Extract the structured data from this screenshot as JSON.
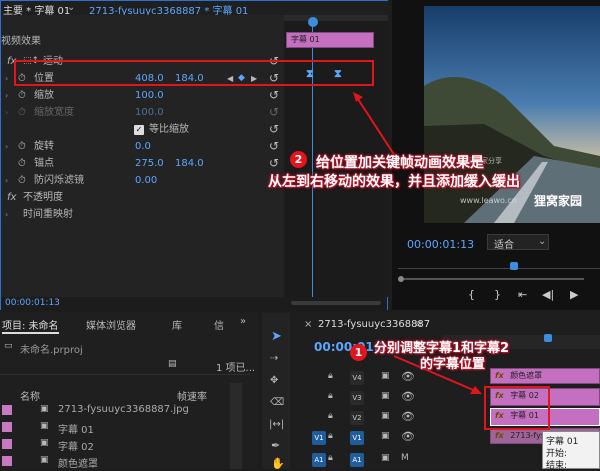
{
  "effect_controls": {
    "tab_title": "主要 * 字幕 01",
    "sequence_clip": "2713-fysuuyc3368887 * 字幕 01",
    "video_effects": "视频效果",
    "motion": "运动",
    "position": {
      "label": "位置",
      "x": "408.0",
      "y": "184.0"
    },
    "scale": {
      "label": "缩放",
      "value": "100.0"
    },
    "scale_width": {
      "label": "缩放宽度",
      "value": "100.0"
    },
    "uniform_scale": "等比缩放",
    "rotation": {
      "label": "旋转",
      "value": "0.0"
    },
    "anchor": {
      "label": "锚点",
      "x": "275.0",
      "y": "184.0"
    },
    "antiflicker": {
      "label": "防闪烁滤镜",
      "value": "0.00"
    },
    "opacity": "不透明度",
    "time_remap": "时间重映射",
    "timecode": "00:00:01:13",
    "timeline_clip": "字幕 01",
    "fx_glyph": "fx"
  },
  "program": {
    "timecode": "00:00:01:13",
    "fit": "适合",
    "watermark_site": "www.leawo.cn",
    "watermark_brand": "狸窝家园",
    "watermark_top": "狸窝万家分享"
  },
  "project": {
    "tab_project": "项目: 未命名",
    "tab_media": "媒体浏览器",
    "tab_library": "库",
    "tab_info": "信",
    "filename": "未命名.prproj",
    "count": "1 项已...",
    "col_name": "名称",
    "col_rate": "帧速率",
    "items": [
      {
        "name": "2713-fysuuyc3368887.jpg",
        "color": "#c77ac0"
      },
      {
        "name": "字幕 01",
        "color": "#c77ac0"
      },
      {
        "name": "字幕 02",
        "color": "#c77ac0"
      },
      {
        "name": "颜色遮罩",
        "color": "#c77ac0"
      }
    ]
  },
  "timeline": {
    "tab": "2713-fysuuyc3368887",
    "timecode": "00:00:01:13",
    "tracks": {
      "v4": "V4",
      "v3": "V3",
      "v2": "V2",
      "v1": "V1",
      "a1": "A1",
      "src_v1": "V1",
      "src_a1": "A1"
    },
    "clips": {
      "mask": "颜色遮罩",
      "sub02": "字幕 02",
      "sub01": "字幕 01",
      "image": "2713-fysuu"
    },
    "tooltip": {
      "name": "字幕 01",
      "start_label": "开始:",
      "end_label": "结束:"
    }
  },
  "annotations": {
    "note1": {
      "badge": "1",
      "line1": "分别调整字幕1和字幕2",
      "line2": "的字幕位置"
    },
    "note2": {
      "badge": "2",
      "line1": "给位置加关键帧动画效果是",
      "line2": "从左到右移动的效果，并且添加缓入缓出"
    }
  },
  "colors": {
    "accent": "#5ca6ff",
    "clip": "#c56fc0",
    "callout": "#e2141c"
  }
}
